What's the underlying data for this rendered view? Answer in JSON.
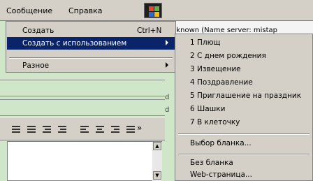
{
  "menubar": {
    "messages": "Сообщение",
    "help": "Справка"
  },
  "background": {
    "recipient_text": "nknown (Name server: mistap",
    "side_marks": [
      "d",
      "d"
    ]
  },
  "menu": {
    "create": "Создать",
    "create_shortcut": "Ctrl+N",
    "create_with": "Создать с использованием",
    "other": "Разное"
  },
  "submenu": {
    "items": [
      "1 Плющ",
      "2 С днем рождения",
      "3 Извещение",
      "4 Поздравление",
      "5 Приглашение на праздник",
      "6 Шашки",
      "7 В клеточку"
    ],
    "select_template": "Выбор бланка...",
    "no_template": "Без бланка",
    "web_page": "Web-страница..."
  },
  "toolbar": {
    "more": "»"
  }
}
